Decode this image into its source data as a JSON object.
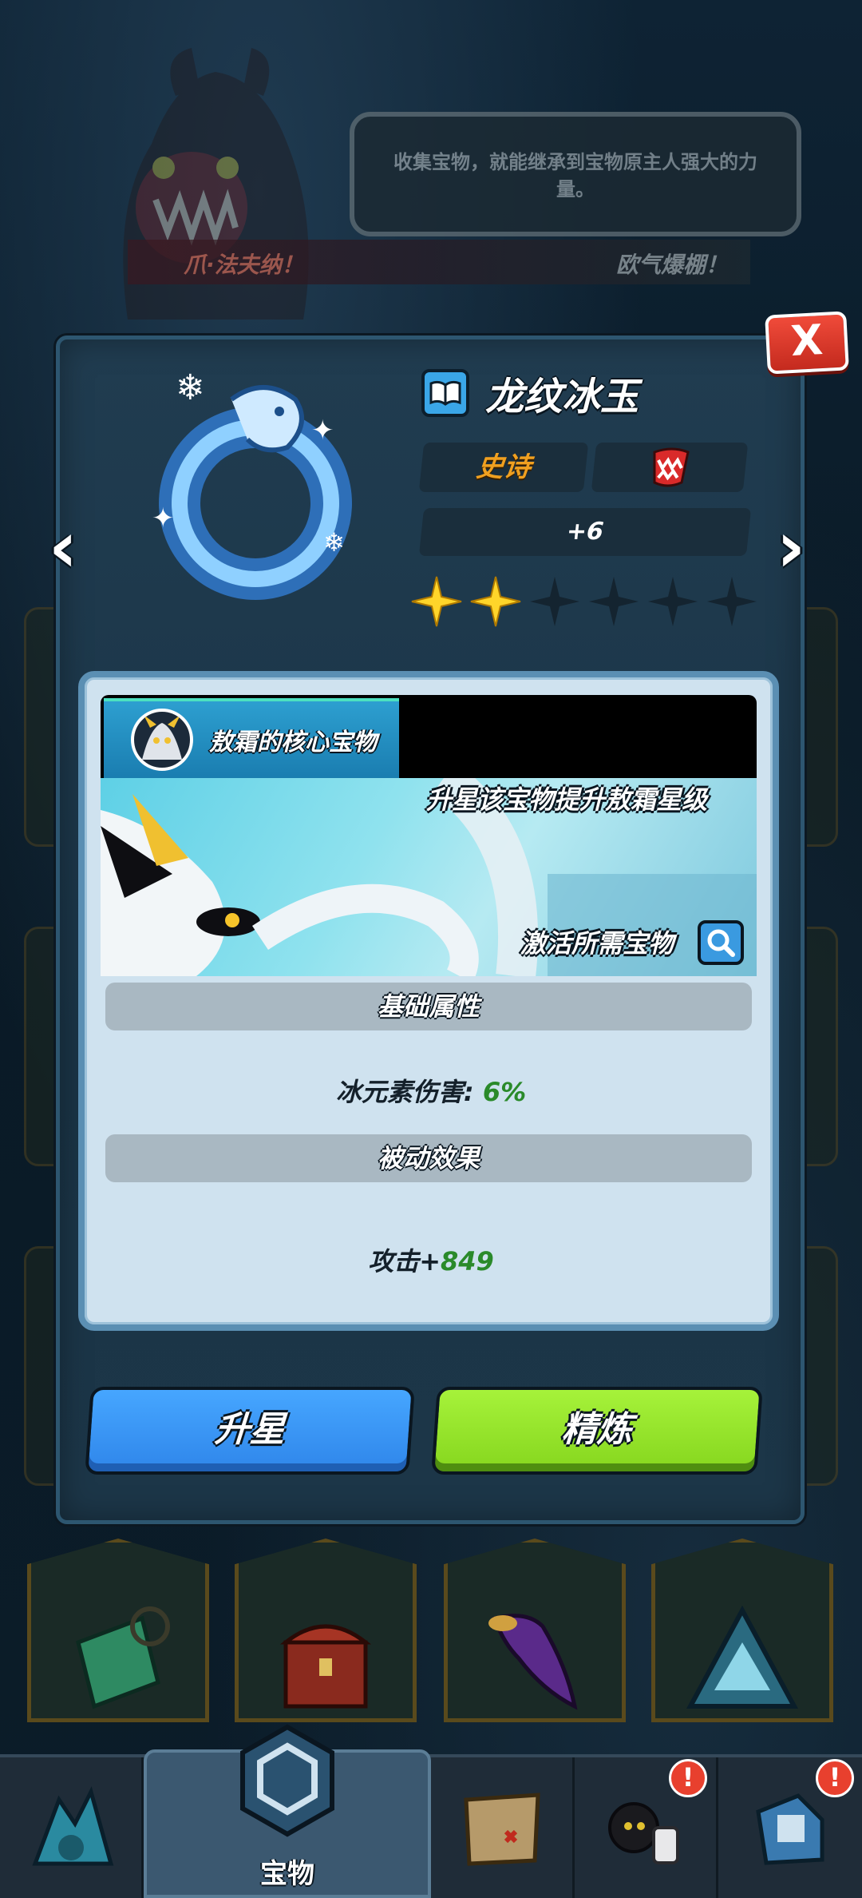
{
  "background": {
    "speech_text": "收集宝物，就能继承到宝物原主人强大的力量。",
    "banner_left": "爪·法夫纳！",
    "banner_right": "欧气爆棚！"
  },
  "modal": {
    "close_label": "X",
    "prev_arrow": "‹",
    "next_arrow": "›",
    "item_name": "龙纹冰玉",
    "rarity": "史诗",
    "level": "+6",
    "stars_filled": 2,
    "stars_total": 6,
    "core": {
      "title": "敖霜的核心宝物",
      "caption_top": "升星该宝物提升敖霜星级",
      "caption_bottom": "激活所需宝物"
    },
    "base_section": "基础属性",
    "base_stat_label": "冰元素伤害:",
    "base_stat_value": "6%",
    "passive_section": "被动效果",
    "passive_stat_label": "攻击+",
    "passive_stat_value": "849",
    "btn_star": "升星",
    "btn_refine": "精炼"
  },
  "nav": {
    "active_label": "宝物",
    "badges": [
      "!",
      "!"
    ]
  },
  "colors": {
    "accent_blue": "#2f86ea",
    "accent_green": "#86d61e",
    "rarity_epic": "#f0a020",
    "close_red": "#e0392a",
    "stat_green": "#2a8a2a"
  }
}
